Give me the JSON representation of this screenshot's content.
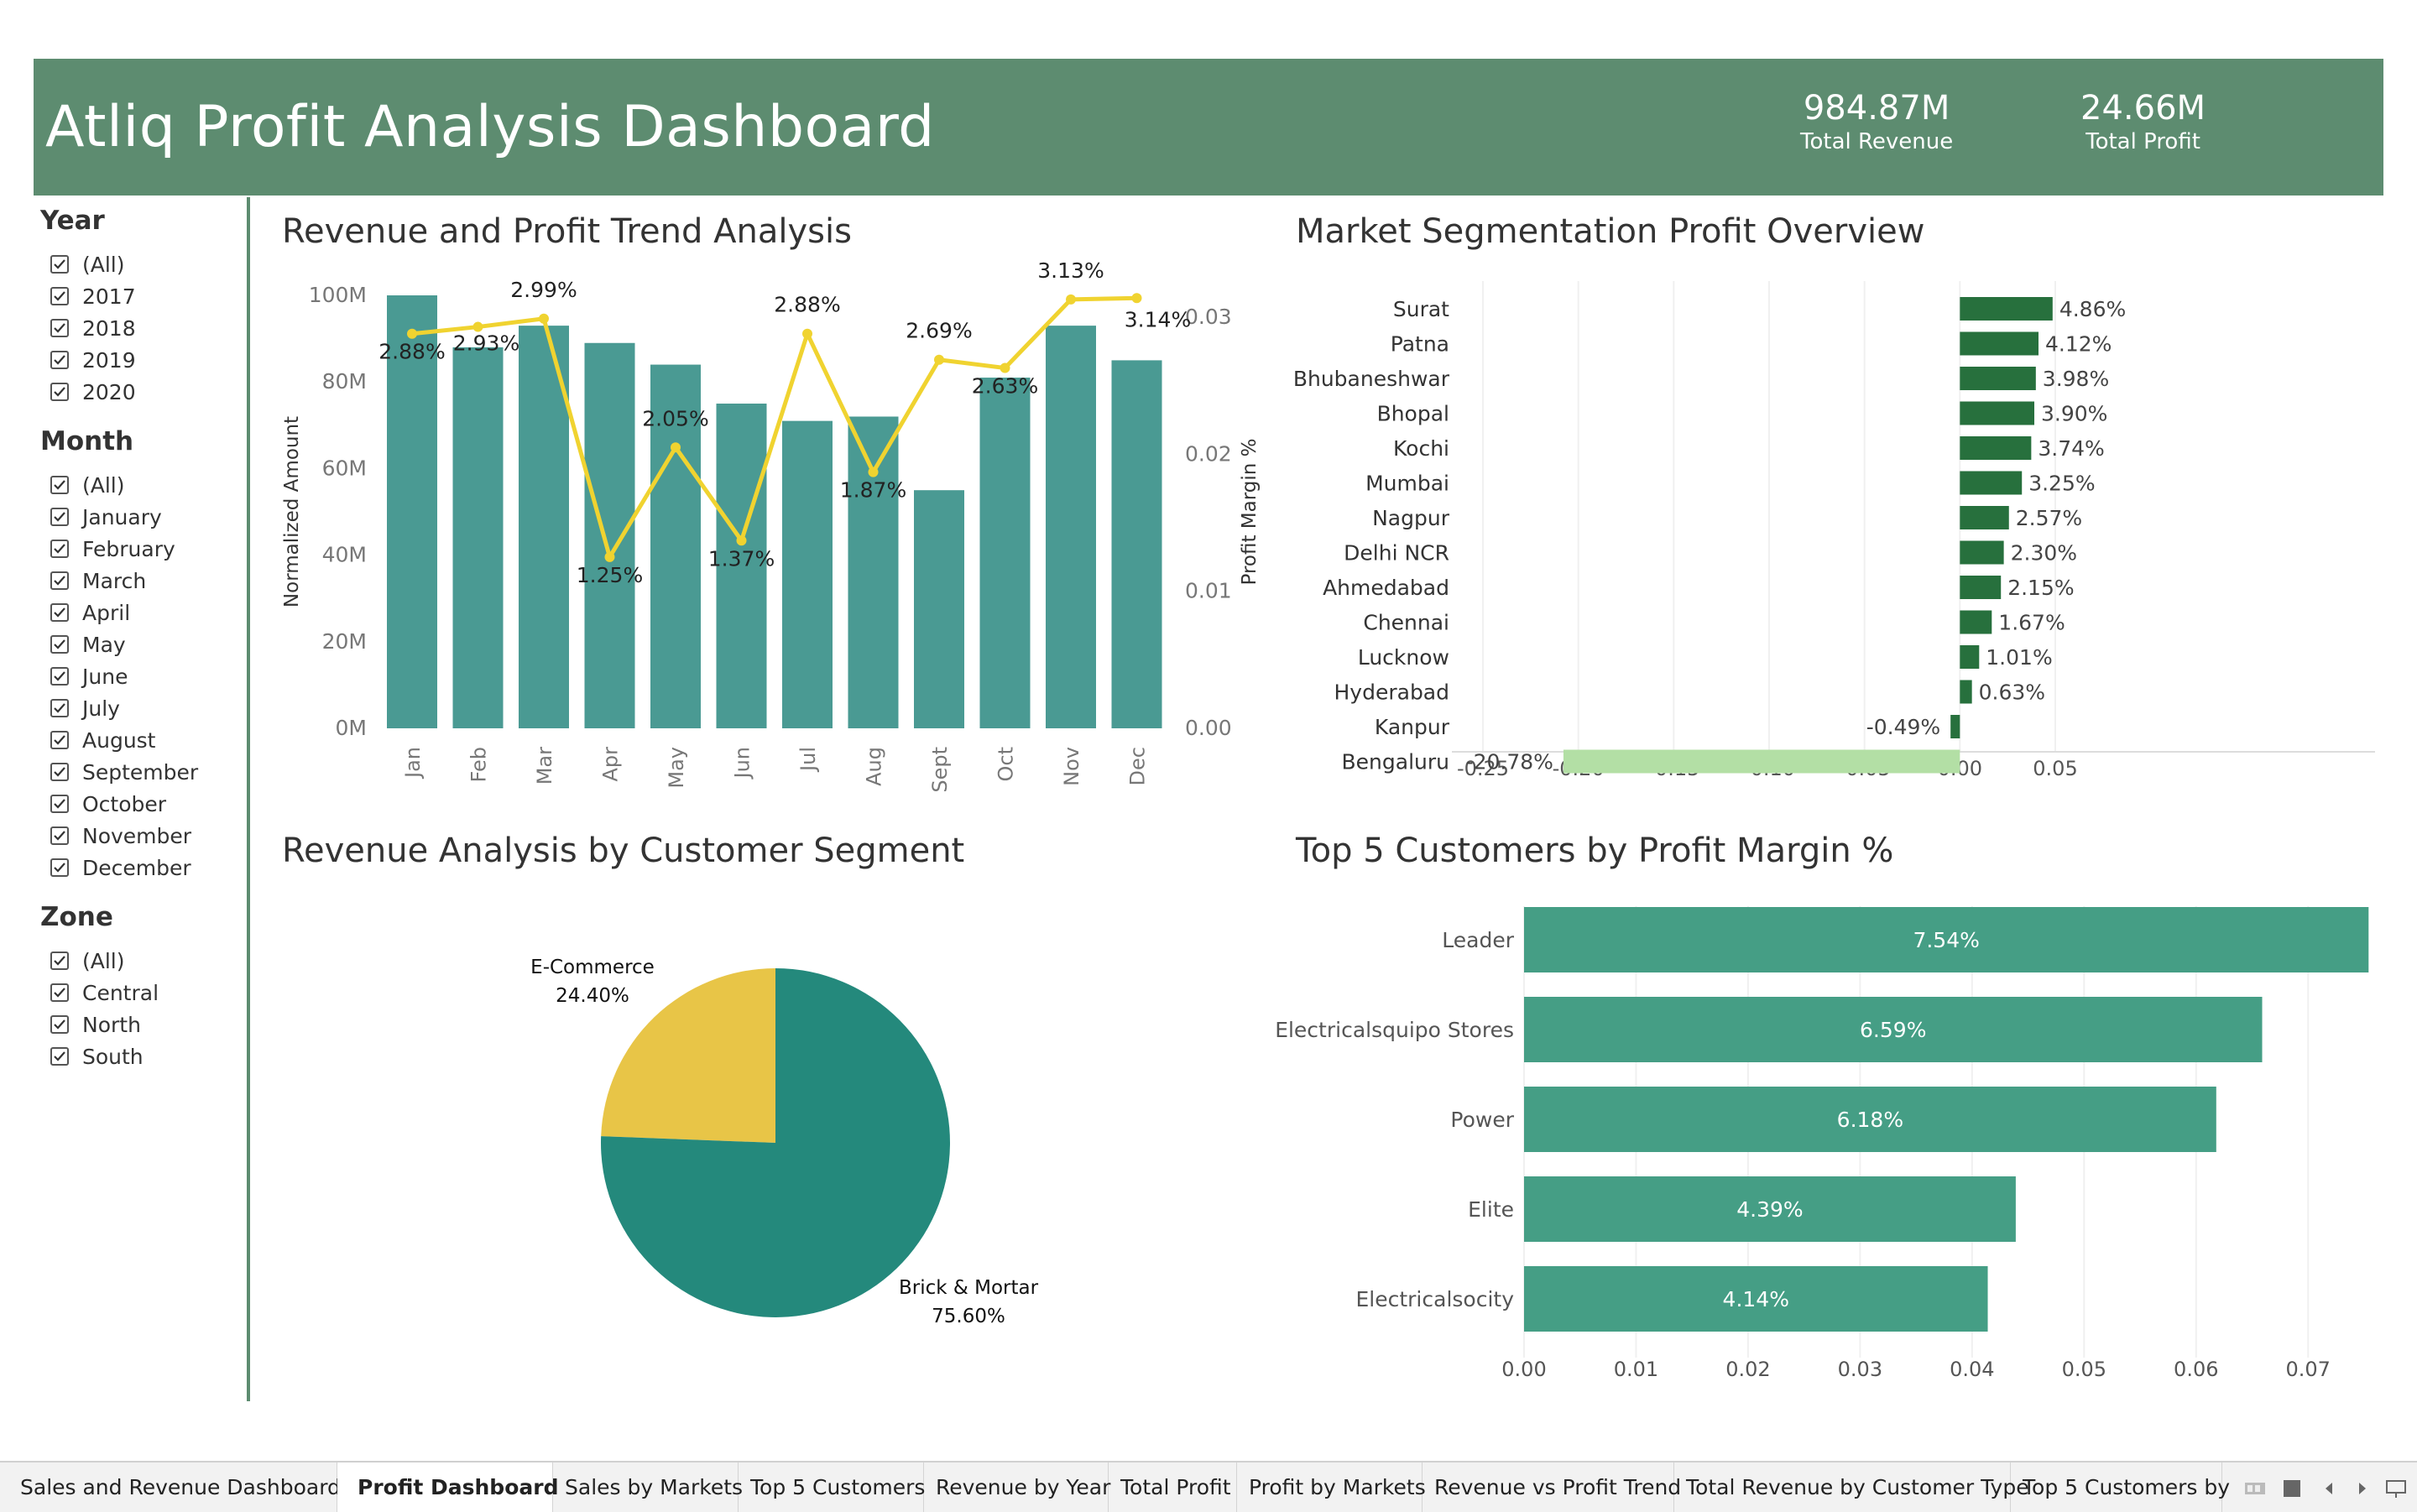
{
  "header": {
    "title": "Atliq Profit Analysis Dashboard",
    "kpis": [
      {
        "value": "984.87M",
        "label": "Total Revenue"
      },
      {
        "value": "24.66M",
        "label": "Total Profit"
      }
    ]
  },
  "filters": {
    "year": {
      "title": "Year",
      "items": [
        "(All)",
        "2017",
        "2018",
        "2019",
        "2020"
      ]
    },
    "month": {
      "title": "Month",
      "items": [
        "(All)",
        "January",
        "February",
        "March",
        "April",
        "May",
        "June",
        "July",
        "August",
        "September",
        "October",
        "November",
        "December"
      ]
    },
    "zone": {
      "title": "Zone",
      "items": [
        "(All)",
        "Central",
        "North",
        "South"
      ]
    }
  },
  "panels": {
    "trend_title": "Revenue and Profit Trend Analysis",
    "market_title": "Market Segmentation Profit Overview",
    "segment_title": "Revenue Analysis by Customer Segment",
    "top5_title": "Top 5 Customers by Profit Margin %"
  },
  "colors": {
    "header": "#5d8c70",
    "bar_teal": "#4a9a93",
    "line_yellow": "#f0d330",
    "market_dark": "#27703d",
    "market_light": "#b3dfa5",
    "pie_teal": "#24897c",
    "pie_yellow": "#e8c547",
    "top5_bar": "#459e85"
  },
  "chart_data": [
    {
      "type": "bar",
      "title": "Revenue and Profit Trend Analysis",
      "categories": [
        "Jan",
        "Feb",
        "Mar",
        "Apr",
        "May",
        "Jun",
        "Jul",
        "Aug",
        "Sept",
        "Oct",
        "Nov",
        "Dec"
      ],
      "series": [
        {
          "values": [
            100,
            88,
            93,
            89,
            84,
            75,
            71,
            72,
            55,
            81,
            93,
            85
          ]
        },
        {
          "values": [
            0.0288,
            0.0293,
            0.0299,
            0.0125,
            0.0205,
            0.0137,
            0.0288,
            0.0187,
            0.0269,
            0.0263,
            0.0313,
            0.0314
          ],
          "labels": [
            "2.88%",
            "2.93%",
            "2.99%",
            "1.25%",
            "2.05%",
            "1.37%",
            "2.88%",
            "1.87%",
            "2.69%",
            "2.63%",
            "3.13%",
            "3.14%"
          ]
        }
      ],
      "ylabel": "Normalized Amount",
      "y2label": "Profit Margin %",
      "ylim": [
        0,
        100
      ],
      "y2lim": [
        0,
        0.0316
      ],
      "yticks": [
        "0M",
        "20M",
        "40M",
        "60M",
        "80M",
        "100M"
      ],
      "y2ticks": [
        "0.00",
        "0.01",
        "0.02",
        "0.03"
      ]
    },
    {
      "type": "bar",
      "title": "Market Segmentation Profit Overview",
      "categories": [
        "Surat",
        "Patna",
        "Bhubaneshwar",
        "Bhopal",
        "Kochi",
        "Mumbai",
        "Nagpur",
        "Delhi NCR",
        "Ahmedabad",
        "Chennai",
        "Lucknow",
        "Hyderabad",
        "Kanpur",
        "Bengaluru"
      ],
      "values": [
        0.0486,
        0.0412,
        0.0398,
        0.039,
        0.0374,
        0.0325,
        0.0257,
        0.023,
        0.0215,
        0.0167,
        0.0101,
        0.0063,
        -0.0049,
        -0.2078
      ],
      "labels": [
        "4.86%",
        "4.12%",
        "3.98%",
        "3.90%",
        "3.74%",
        "3.25%",
        "2.57%",
        "2.30%",
        "2.15%",
        "1.67%",
        "1.01%",
        "0.63%",
        "-0.49%",
        "-20.78%"
      ],
      "xlim": [
        -0.25,
        0.05
      ],
      "xticks": [
        "-0.25",
        "-0.20",
        "-0.15",
        "-0.10",
        "-0.05",
        "0.00",
        "0.05"
      ]
    },
    {
      "type": "pie",
      "title": "Revenue Analysis by Customer Segment",
      "categories": [
        "E-Commerce",
        "Brick & Mortar"
      ],
      "values": [
        24.4,
        75.6
      ],
      "labels": [
        "24.40%",
        "75.60%"
      ]
    },
    {
      "type": "bar",
      "title": "Top 5 Customers by Profit Margin %",
      "categories": [
        "Leader",
        "Electricalsquipo Stores",
        "Power",
        "Elite",
        "Electricalsocity"
      ],
      "values": [
        0.0754,
        0.0659,
        0.0618,
        0.0439,
        0.0414
      ],
      "labels": [
        "7.54%",
        "6.59%",
        "6.18%",
        "4.39%",
        "4.14%"
      ],
      "xlim": [
        0,
        0.078
      ],
      "xticks": [
        "0.00",
        "0.01",
        "0.02",
        "0.03",
        "0.04",
        "0.05",
        "0.06",
        "0.07"
      ]
    }
  ],
  "tabs": {
    "items": [
      "Sales and Revenue Dashboard",
      "Profit Dashboard",
      "Sales by Markets",
      "Top 5 Customers",
      "Revenue by Year",
      "Total Profit",
      "Profit by Markets",
      "Revenue vs Profit Trend",
      "Total Revenue by Customer Type",
      "Top 5 Customers by"
    ],
    "active": 1
  }
}
